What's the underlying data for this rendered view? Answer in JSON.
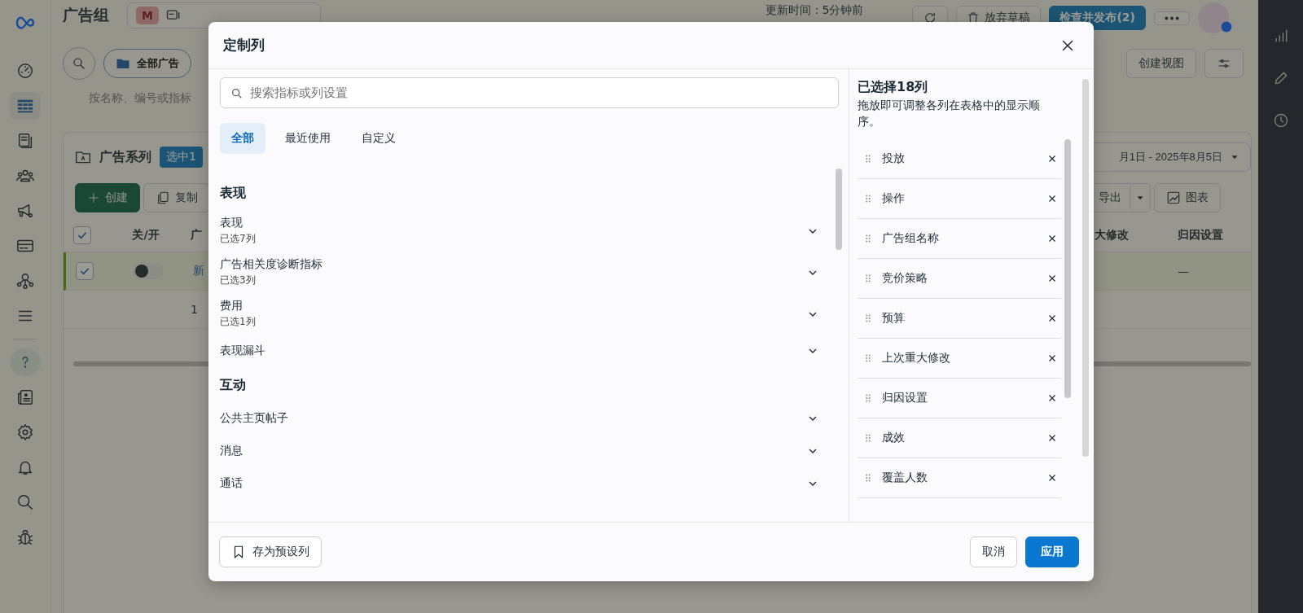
{
  "nav": [
    {
      "selected": false
    },
    {
      "selected": true
    },
    {
      "selected": false
    },
    {
      "selected": false
    },
    {
      "selected": false
    },
    {
      "selected": false
    },
    {
      "selected": false
    },
    {
      "selected": false
    },
    {
      "selected": false
    },
    {
      "selected": false
    },
    {
      "selected": false
    },
    {
      "selected": false
    },
    {
      "selected": false
    },
    {
      "selected": false
    }
  ],
  "topbar": {
    "title": "广告组",
    "account_badge": "M",
    "updated": "更新时间：5分钟前",
    "discard": "放弃草稿",
    "publish": "检查并发布(2)"
  },
  "toolbar": {
    "filter": "全部广告",
    "create_view": "创建视图",
    "search_hint": "按名称、编号或指标"
  },
  "campaign": {
    "label": "广告系列",
    "selected_badge": "选中1",
    "date_range": "月1日 - 2025年8月5日",
    "create": "创建",
    "copy": "复制",
    "export": "导出",
    "chart": "图表"
  },
  "table": {
    "all_checked": true,
    "columns": [
      "关/开",
      "广",
      "大修改",
      "归因设置"
    ],
    "rows": [
      {
        "checked": true,
        "on": false,
        "cells": [
          "",
          "新",
          "",
          "—"
        ]
      },
      {
        "checked": false,
        "cells": [
          "",
          "1",
          "",
          ""
        ]
      }
    ]
  },
  "dialog": {
    "title": "定制列",
    "search": {
      "placeholder": "搜索指标或列设置"
    },
    "tabs": [
      {
        "label": "全部",
        "selected": true
      },
      {
        "label": "最近使用",
        "selected": false
      },
      {
        "label": "自定义",
        "selected": false
      }
    ],
    "groups": [
      {
        "heading": "表现",
        "items": [
          {
            "label": "表现",
            "note": "已选7列",
            "expanded": false
          },
          {
            "label": "广告相关度诊断指标",
            "note": "已选3列",
            "expanded": false
          },
          {
            "label": "费用",
            "note": "已选1列",
            "expanded": false
          },
          {
            "label": "表现漏斗",
            "expanded": false
          }
        ]
      },
      {
        "heading": "互动",
        "items": [
          {
            "label": "公共主页帖子",
            "expanded": false
          },
          {
            "label": "消息",
            "expanded": false
          },
          {
            "label": "通话",
            "expanded": false
          }
        ]
      }
    ],
    "selected_panel": {
      "heading": "已选择18列",
      "hint": "拖放即可调整各列在表格中的显示顺序。",
      "columns": [
        "投放",
        "操作",
        "广告组名称",
        "竞价策略",
        "预算",
        "上次重大修改",
        "归因设置",
        "成效",
        "覆盖人数"
      ]
    },
    "save_preset": "存为预设列",
    "cancel": "取消",
    "apply": "应用"
  }
}
